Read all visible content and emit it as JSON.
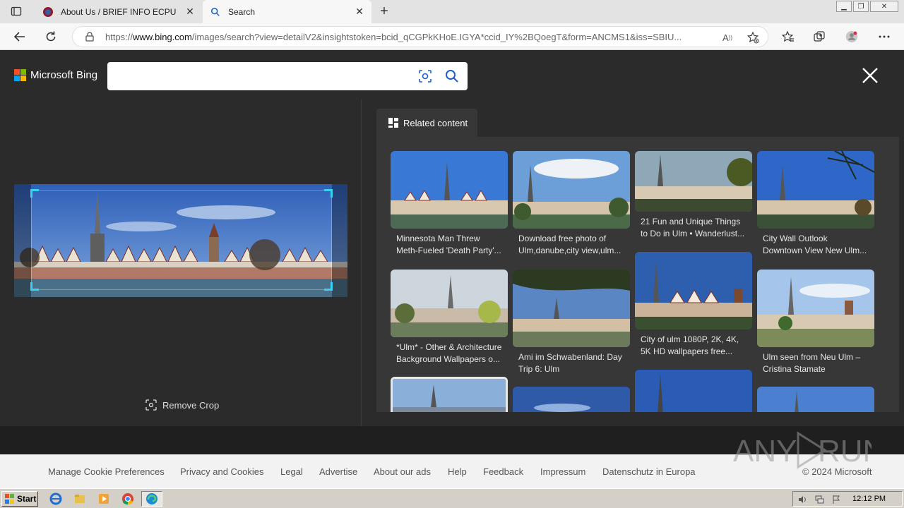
{
  "browser": {
    "tabs": [
      {
        "title": "About Us / BRIEF INFO ECPU",
        "active": false
      },
      {
        "title": "Search",
        "active": true
      }
    ],
    "url_scheme_prefix": "https://",
    "url_host": "www.bing.com",
    "url_rest": "/images/search?view=detailV2&insightstoken=bcid_qCGPkKHoE.IGYA*ccid_IY%2BQoegT&form=ANCMS1&iss=SBIU..."
  },
  "bing": {
    "logo_text": "Microsoft Bing",
    "search_placeholder": "",
    "remove_crop_label": "Remove Crop",
    "related_tab_label": "Related content"
  },
  "related": [
    {
      "caption": "Minnesota Man Threw Meth-Fueled 'Death Party'..."
    },
    {
      "caption": "Download free photo of Ulm,danube,city view,ulm..."
    },
    {
      "caption": "21 Fun and Unique Things to Do in Ulm • Wanderlust..."
    },
    {
      "caption": "City Wall Outlook Downtown View New Ulm..."
    },
    {
      "caption": "*Ulm* - Other & Architecture Background Wallpapers o..."
    },
    {
      "caption": "Ami im Schwabenland: Day Trip 6: Ulm"
    },
    {
      "caption": "City of ulm 1080P, 2K, 4K, 5K HD wallpapers free..."
    },
    {
      "caption": "Ulm seen from Neu Ulm – Cristina Stamate"
    }
  ],
  "footer": {
    "links": [
      "Manage Cookie Preferences",
      "Privacy and Cookies",
      "Legal",
      "Advertise",
      "About our ads",
      "Help",
      "Feedback",
      "Impressum",
      "Datenschutz in Europa"
    ],
    "copyright": "© 2024 Microsoft"
  },
  "watermark": "ANY RUN",
  "taskbar": {
    "start_label": "Start",
    "clock": "12:12 PM"
  },
  "colors": {
    "accent_crop": "#38d1f0",
    "page_bg": "#2b2b2b",
    "panel_bg": "#373737"
  }
}
